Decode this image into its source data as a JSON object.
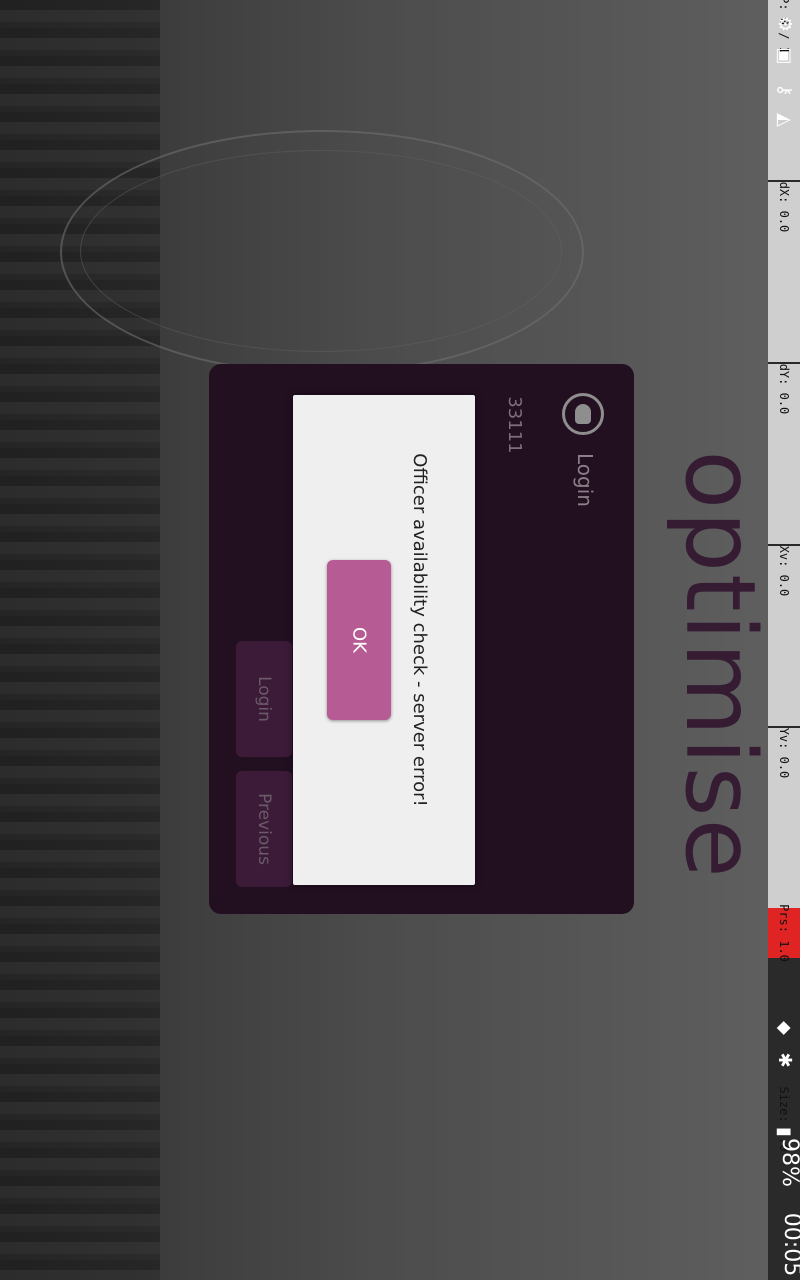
{
  "brand": {
    "logo_text": "optimise",
    "colors": {
      "card": "#220f20",
      "button": "#3b1b38",
      "ok": "#b65b93"
    }
  },
  "login_card": {
    "title": "Login",
    "username_value": "33111",
    "buttons": {
      "login": "Login",
      "previous": "Previous"
    }
  },
  "dialog": {
    "message": "Officer availability check - server error!",
    "ok_label": "OK"
  },
  "statusbar": {
    "labels": [
      "P: 0 / 1",
      "dX: 0.0",
      "dY: 0.0",
      "Xv: 0.0",
      "Yv: 0.0",
      "Prs: 1.0",
      "Size: 1.0"
    ],
    "battery": "98%",
    "time": "00:05",
    "icons": [
      "settings-icon",
      "screenshot-icon",
      "key-icon",
      "wifi-icon",
      "location-icon",
      "bluetooth-icon",
      "signal-icon",
      "battery-icon"
    ]
  }
}
